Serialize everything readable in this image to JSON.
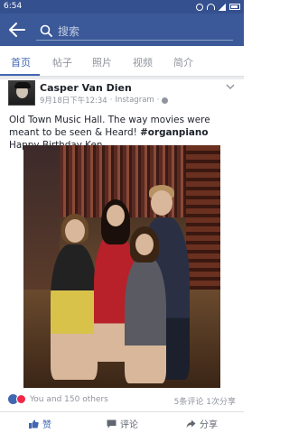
{
  "status": {
    "time": "6:54"
  },
  "search": {
    "placeholder": "搜索"
  },
  "tabs": [
    {
      "label": "首页"
    },
    {
      "label": "帖子"
    },
    {
      "label": "照片"
    },
    {
      "label": "视频"
    },
    {
      "label": "简介"
    }
  ],
  "post": {
    "author": "Casper Van Dien",
    "date": "9月18日下午12:34",
    "source": "Instagram",
    "text_before": "Old Town Music Hall. The way movies were meant to be seen & Heard! ",
    "hashtag": "#organpiano",
    "text_after": " Happy Birthday Ken",
    "reactions_text": "You and 150 others",
    "comments": "5条评论",
    "shares": "1次分享"
  },
  "actions": {
    "like": "赞",
    "comment": "评论",
    "share": "分享"
  },
  "colors": {
    "brand": "#3b5998",
    "accent": "#4267b2",
    "love": "#f0284a"
  }
}
